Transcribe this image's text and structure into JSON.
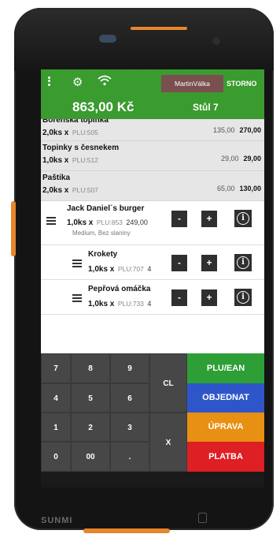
{
  "device": {
    "brand": "SUNMI"
  },
  "header": {
    "user": "MartinVálka",
    "storno_label": "STORNO",
    "total": "863,00 Kč",
    "table": "Stůl 7"
  },
  "items": [
    {
      "name": "Bořenská topinka",
      "qty": "2,0ks x",
      "plu": "PLU:505",
      "unit_price": "135,00",
      "total": "270,00"
    },
    {
      "name": "Topinky s česnekem",
      "qty": "1,0ks x",
      "plu": "PLU:512",
      "unit_price": "29,00",
      "total": "29,00"
    },
    {
      "name": "Paštika",
      "qty": "2,0ks x",
      "plu": "PLU:507",
      "unit_price": "65,00",
      "total": "130,00"
    }
  ],
  "active_items": [
    {
      "name": "Jack Daniel´s burger",
      "qty": "1,0ks x",
      "plu": "PLU:853",
      "price": "249,00",
      "note": "Medium, Bez slaniny"
    },
    {
      "name": "Krokety",
      "qty": "1,0ks x",
      "plu": "PLU:707",
      "price": "4"
    },
    {
      "name": "Pepřová omáčka",
      "qty": "1,0ks x",
      "plu": "PLU:733",
      "price": "4"
    }
  ],
  "item_buttons": {
    "minus": "-",
    "plus": "+",
    "info": "i"
  },
  "keypad": {
    "keys": [
      "7",
      "8",
      "9",
      "4",
      "5",
      "6",
      "1",
      "2",
      "3",
      "0",
      "00",
      "."
    ],
    "cl": "CL",
    "x": "X"
  },
  "actions": [
    {
      "label": "PLU/EAN",
      "color": "#2e9e36"
    },
    {
      "label": "OBJEDNAT",
      "color": "#2f56c9"
    },
    {
      "label": "ÚPRAVA",
      "color": "#e89012"
    },
    {
      "label": "PLATBA",
      "color": "#de1f24"
    }
  ],
  "colors": {
    "header_green": "#3a9b2f",
    "accent_orange": "#e8862b"
  }
}
